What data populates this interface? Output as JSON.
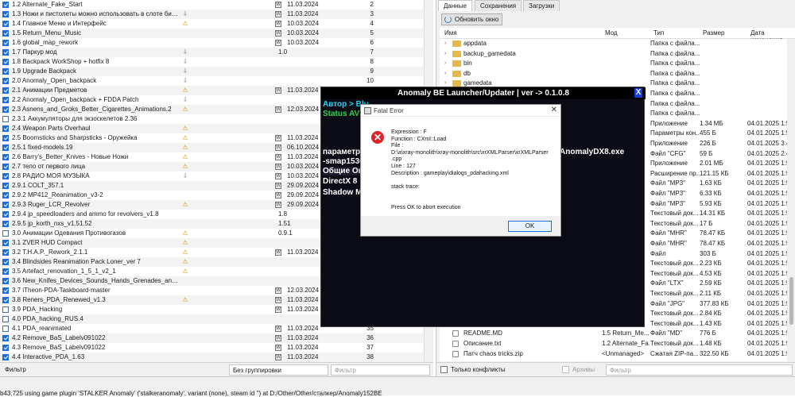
{
  "modlist": {
    "rows": [
      {
        "name": "1.2 Alternate_Fake_Start",
        "flag": "",
        "version": "",
        "date": "11.03.2024",
        "priority": "2",
        "checked": true
      },
      {
        "name": "1.3 Ножи и пистолеты можно использовать в слоте бинокля",
        "flag": "key",
        "version": "",
        "date": "11.03.2024",
        "priority": "3",
        "checked": true
      },
      {
        "name": "1.4 Главное Меню и Интерфейс",
        "flag": "warn",
        "version": "",
        "date": "10.03.2024",
        "priority": "4",
        "checked": true
      },
      {
        "name": "1.5 Return_Menu_Music",
        "flag": "",
        "version": "",
        "date": "10.03.2024",
        "priority": "5",
        "checked": true
      },
      {
        "name": "1.6 global_map_rework",
        "flag": "",
        "version": "",
        "date": "10.03.2024",
        "priority": "6",
        "checked": true
      },
      {
        "name": "1.7 Паркур мод",
        "flag": "key",
        "version": "1.0",
        "date": "",
        "priority": "7",
        "checked": true
      },
      {
        "name": "1.8 Backpack WorkShop + hotfix 8",
        "flag": "key",
        "version": "",
        "date": "",
        "priority": "8",
        "checked": true
      },
      {
        "name": "1.9 Upgrade Backpack",
        "flag": "key",
        "version": "",
        "date": "",
        "priority": "9",
        "checked": true
      },
      {
        "name": "2.0 Anomaly_Open_backpack",
        "flag": "key",
        "version": "",
        "date": "",
        "priority": "10",
        "checked": true
      },
      {
        "name": "2.1 Анимации Предметов",
        "flag": "warn",
        "version": "",
        "date": "11.03.2024",
        "priority": "",
        "checked": true
      },
      {
        "name": "2.2 Anomaly_Open_backpack + FDDA Patch",
        "flag": "key",
        "version": "",
        "date": "",
        "priority": "",
        "checked": true
      },
      {
        "name": "2.3 Asnens_and_Groks_Better_Cigarettes_Animations.2",
        "flag": "warn",
        "version": "",
        "date": "12.03.2024",
        "priority": "",
        "checked": true
      },
      {
        "name": "2.3.1 Аккумуляторы для экзоскелетов 2.36",
        "flag": "",
        "version": "",
        "date": "",
        "priority": "",
        "checked": false
      },
      {
        "name": "2.4 Weapon Parts Overhaul",
        "flag": "warn",
        "version": "",
        "date": "",
        "priority": "",
        "checked": true
      },
      {
        "name": "2.5 Boomsticks and Sharpsticks - Оружейка",
        "flag": "warn",
        "version": "",
        "date": "11.03.2024",
        "priority": "",
        "checked": true
      },
      {
        "name": "2.5.1 fixed-models.19",
        "flag": "warn",
        "version": "",
        "date": "06.10.2024",
        "priority": "",
        "checked": true
      },
      {
        "name": "2.6 Barry's_Better_Knives - Новые Ножи",
        "flag": "warn",
        "version": "",
        "date": "11.03.2024",
        "priority": "",
        "checked": true
      },
      {
        "name": "2.7 тело от первого лица",
        "flag": "warn",
        "version": "",
        "date": "10.03.2024",
        "priority": "",
        "checked": true
      },
      {
        "name": "2.8 РАДИО МОЯ МУЗЫКА",
        "flag": "key",
        "version": "",
        "date": "10.03.2024",
        "priority": "",
        "checked": true
      },
      {
        "name": "2.9.1 COLT_357.1",
        "flag": "",
        "version": "",
        "date": "29.09.2024",
        "priority": "",
        "checked": true
      },
      {
        "name": "2.9.2 MP412_Reanimation_v3-2",
        "flag": "",
        "version": "",
        "date": "29.09.2024",
        "priority": "",
        "checked": true
      },
      {
        "name": "2.9.3 Ruger_LCR_Revolver",
        "flag": "warn",
        "version": "",
        "date": "29.09.2024",
        "priority": "",
        "checked": true
      },
      {
        "name": "2.9.4 jp_speedloaders and ammo for revolvers_v1.8",
        "flag": "",
        "version": "1.8",
        "date": "",
        "priority": "",
        "checked": true
      },
      {
        "name": "2.9.5 jp_korth_nxs_v1.51.52",
        "flag": "",
        "version": "1.51",
        "date": "",
        "priority": "",
        "checked": true
      },
      {
        "name": "3.0 Анимации Одевания Противогазов",
        "flag": "warn",
        "version": "0.9.1",
        "date": "",
        "priority": "",
        "checked": false
      },
      {
        "name": "3.1 ZVER HUD Compact",
        "flag": "warn",
        "version": "",
        "date": "",
        "priority": "",
        "checked": true
      },
      {
        "name": "3.2 T.H.A.P._Rework_2.1.1",
        "flag": "warn",
        "version": "",
        "date": "11.03.2024",
        "priority": "",
        "checked": true
      },
      {
        "name": "3.4 Blindsides Reanimation Pack Loner_ver 7",
        "flag": "warn",
        "version": "",
        "date": "",
        "priority": "",
        "checked": true
      },
      {
        "name": "3.5 Artefact_renovation_1_5_1_v2_1",
        "flag": "warn",
        "version": "",
        "date": "",
        "priority": "",
        "checked": true
      },
      {
        "name": "3.6 New_Knifes_Devices_Sounds_Hands_Grenades_and_Icons",
        "flag": "",
        "version": "",
        "date": "",
        "priority": "",
        "checked": true
      },
      {
        "name": "3.7 iTheon-PDA-Taskboard-master",
        "flag": "",
        "version": "",
        "date": "12.03.2024",
        "priority": "",
        "checked": true
      },
      {
        "name": "3.8 Reners_PDA_Renewed_v1.3",
        "flag": "warn",
        "version": "",
        "date": "11.03.2024",
        "priority": "",
        "checked": true
      },
      {
        "name": "3.9 PDA_Hacking",
        "flag": "",
        "version": "",
        "date": "11.03.2024",
        "priority": "",
        "checked": false
      },
      {
        "name": "4.0 PDA_hacking_RUS.4",
        "flag": "",
        "version": "",
        "date": "",
        "priority": "",
        "checked": false
      },
      {
        "name": "4.1 PDA_reanimated",
        "flag": "",
        "version": "",
        "date": "11.03.2024",
        "priority": "35",
        "checked": false
      },
      {
        "name": "4.2 Remove_BaS_Labelv091022",
        "flag": "",
        "version": "",
        "date": "11.03.2024",
        "priority": "36",
        "checked": true
      },
      {
        "name": "4.3 Remove_BaS_Labelv091022",
        "flag": "",
        "version": "",
        "date": "11.03.2024",
        "priority": "37",
        "checked": true
      },
      {
        "name": "4.4 Interactive_PDA_1.63",
        "flag": "",
        "version": "",
        "date": "11.03.2024",
        "priority": "38",
        "checked": true
      }
    ]
  },
  "filterbar": {
    "label": "Фильтр",
    "grouping": "Без группировки",
    "filter_placeholder": "Фильтр"
  },
  "right": {
    "tabs": [
      "Данные",
      "Сохранения",
      "Загрузки"
    ],
    "refresh_label": "Обновить окно",
    "columns": [
      "Имя",
      "Мод",
      "Тип",
      "Размер",
      "Дата изменения"
    ],
    "rows": [
      {
        "name": "appdata",
        "mod": "",
        "type": "Папка с файла...",
        "size": "",
        "date": "",
        "kind": "folder"
      },
      {
        "name": "backup_gamedata",
        "mod": "",
        "type": "Папка с файла...",
        "size": "",
        "date": "",
        "kind": "folder"
      },
      {
        "name": "bin",
        "mod": "",
        "type": "Папка с файла...",
        "size": "",
        "date": "",
        "kind": "folder"
      },
      {
        "name": "db",
        "mod": "",
        "type": "Папка с файла...",
        "size": "",
        "date": "",
        "kind": "folder"
      },
      {
        "name": "gamedata",
        "mod": "",
        "type": "Папка с файла...",
        "size": "",
        "date": "",
        "kind": "folder"
      },
      {
        "name": "",
        "mod": "",
        "type": "Папка с файла...",
        "size": "",
        "date": "",
        "kind": "none"
      },
      {
        "name": "",
        "mod": "",
        "type": "Папка с файла...",
        "size": "",
        "date": "",
        "kind": "none"
      },
      {
        "name": "",
        "mod": "",
        "type": "Папка с файла...",
        "size": "",
        "date": "",
        "kind": "none"
      },
      {
        "name": "",
        "mod": "",
        "type": "Приложение",
        "size": "1.34 МБ",
        "date": "04.01.2025 1:56",
        "kind": "none"
      },
      {
        "name": "",
        "mod": "",
        "type": "Параметры кон...",
        "size": "455 Б",
        "date": "04.01.2025 1:56",
        "kind": "none"
      },
      {
        "name": "",
        "mod": "",
        "type": "Приложение",
        "size": "226 Б",
        "date": "04.01.2025 3:48",
        "kind": "none"
      },
      {
        "name": "",
        "mod": "",
        "type": "Файл \"CFG\"",
        "size": "59 Б",
        "date": "04.01.2025 2:47",
        "kind": "none"
      },
      {
        "name": "",
        "mod": "",
        "type": "Приложение",
        "size": "2.01 МБ",
        "date": "04.01.2025 1:56",
        "kind": "none"
      },
      {
        "name": "",
        "mod": "",
        "type": "Расширение пр...",
        "size": "121.15 КБ",
        "date": "04.01.2025 1:56",
        "kind": "none"
      },
      {
        "name": "",
        "mod": "",
        "type": "Файл \"MP3\"",
        "size": "1.63 КБ",
        "date": "04.01.2025 1:56",
        "kind": "none"
      },
      {
        "name": "",
        "mod": "",
        "type": "Файл \"MP3\"",
        "size": "6.33 КБ",
        "date": "04.01.2025 1:56",
        "kind": "none"
      },
      {
        "name": "",
        "mod": "",
        "type": "Файл \"MP3\"",
        "size": "5.93 КБ",
        "date": "04.01.2025 1:56",
        "kind": "none"
      },
      {
        "name": "",
        "mod": "",
        "type": "Текстовый док...",
        "size": "14.31 КБ",
        "date": "04.01.2025 1:56",
        "kind": "none"
      },
      {
        "name": "",
        "mod": "",
        "type": "Текстовый док...",
        "size": "17 Б",
        "date": "04.01.2025 1:56",
        "kind": "none"
      },
      {
        "name": "",
        "mod": "",
        "type": "Файл \"MHR\"",
        "size": "78.47 КБ",
        "date": "04.01.2025 1:56",
        "kind": "none"
      },
      {
        "name": "",
        "mod": "",
        "type": "Файл \"MHR\"",
        "size": "78.47 КБ",
        "date": "04.01.2025 1:56",
        "kind": "none"
      },
      {
        "name": "",
        "mod": "",
        "type": "Файл",
        "size": "303 Б",
        "date": "04.01.2025 1:56",
        "kind": "none"
      },
      {
        "name": "",
        "mod": "",
        "type": "Текстовый док...",
        "size": "2.23 КБ",
        "date": "04.01.2025 1:56",
        "kind": "none"
      },
      {
        "name": "",
        "mod": "",
        "type": "Текстовый док...",
        "size": "4.53 КБ",
        "date": "04.01.2025 1:56",
        "kind": "none"
      },
      {
        "name": "",
        "mod": "",
        "type": "Файл \"LTX\"",
        "size": "2.59 КБ",
        "date": "04.01.2025 1:56",
        "kind": "none"
      },
      {
        "name": "",
        "mod": "",
        "type": "Текстовый док...",
        "size": "2.11 КБ",
        "date": "04.01.2025 1:56",
        "kind": "none"
      },
      {
        "name": "",
        "mod": "",
        "type": "Файл \"JPG\"",
        "size": "377.83 КБ",
        "date": "04.01.2025 1:56",
        "kind": "none"
      },
      {
        "name": "",
        "mod": "",
        "type": "Текстовый док...",
        "size": "2.84 КБ",
        "date": "04.01.2025 1:56",
        "kind": "none"
      },
      {
        "name": "",
        "mod": "",
        "type": "Текстовый док...",
        "size": "1.43 КБ",
        "date": "04.01.2025 1:56",
        "kind": "none"
      },
      {
        "name": "README.MD",
        "mod": "1.5 Return_Me...",
        "type": "Файл \"MD\"",
        "size": "776 Б",
        "date": "04.01.2025 1:56",
        "kind": "file"
      },
      {
        "name": "Описание.txt",
        "mod": "1.2 Alternate_Fa...",
        "type": "Текстовый док...",
        "size": "1.48 КБ",
        "date": "04.01.2025 1:56",
        "kind": "file"
      },
      {
        "name": "Патч chaos tricks.zip",
        "mod": "<Unmanaged>",
        "type": "Сжатая ZIP-па...",
        "size": "322.50 КБ",
        "date": "04.01.2025 1:56",
        "kind": "file"
      }
    ],
    "no_conflicts": "Только конфликты",
    "archives": "Архивы",
    "filter_placeholder": "Фильтр"
  },
  "launcher": {
    "title": "Anomaly BE Launcher/Updater | ver -> 0.1.0.8",
    "close": "X",
    "line_author": "Автор > Blu",
    "line_status": "Status AV",
    "line_params": "параметры",
    "line_smap": "-smap1536",
    "line_exe": "AnomalyDX8.exe",
    "line_tabs": "Общие Or",
    "line_dx": "DirectX 8",
    "line_shadow": "Shadow Ma"
  },
  "dialog": {
    "title": "Fatal Error",
    "close": "✕",
    "lines": [
      "Expression    : F",
      "Function      : CXml::Load",
      "File          :",
      "D:\\a\\xray-monolith\\xray-monolith\\src\\xrXMLParser\\xrXMLParser",
      ".cpp",
      "Line          : 127",
      "Description   : gameplay\\dialogs_pdahacking.xml",
      "",
      "stack trace:",
      "",
      "",
      "Press OK to abort execution"
    ],
    "ok": "OK"
  },
  "statusbar": {
    "text": "b43.725   using game plugin 'STALKER Anomaly' ('stalkeranomaly', variant (none), steam id '') at D:/Other/Other/сталкер/Anomaly152BE"
  }
}
